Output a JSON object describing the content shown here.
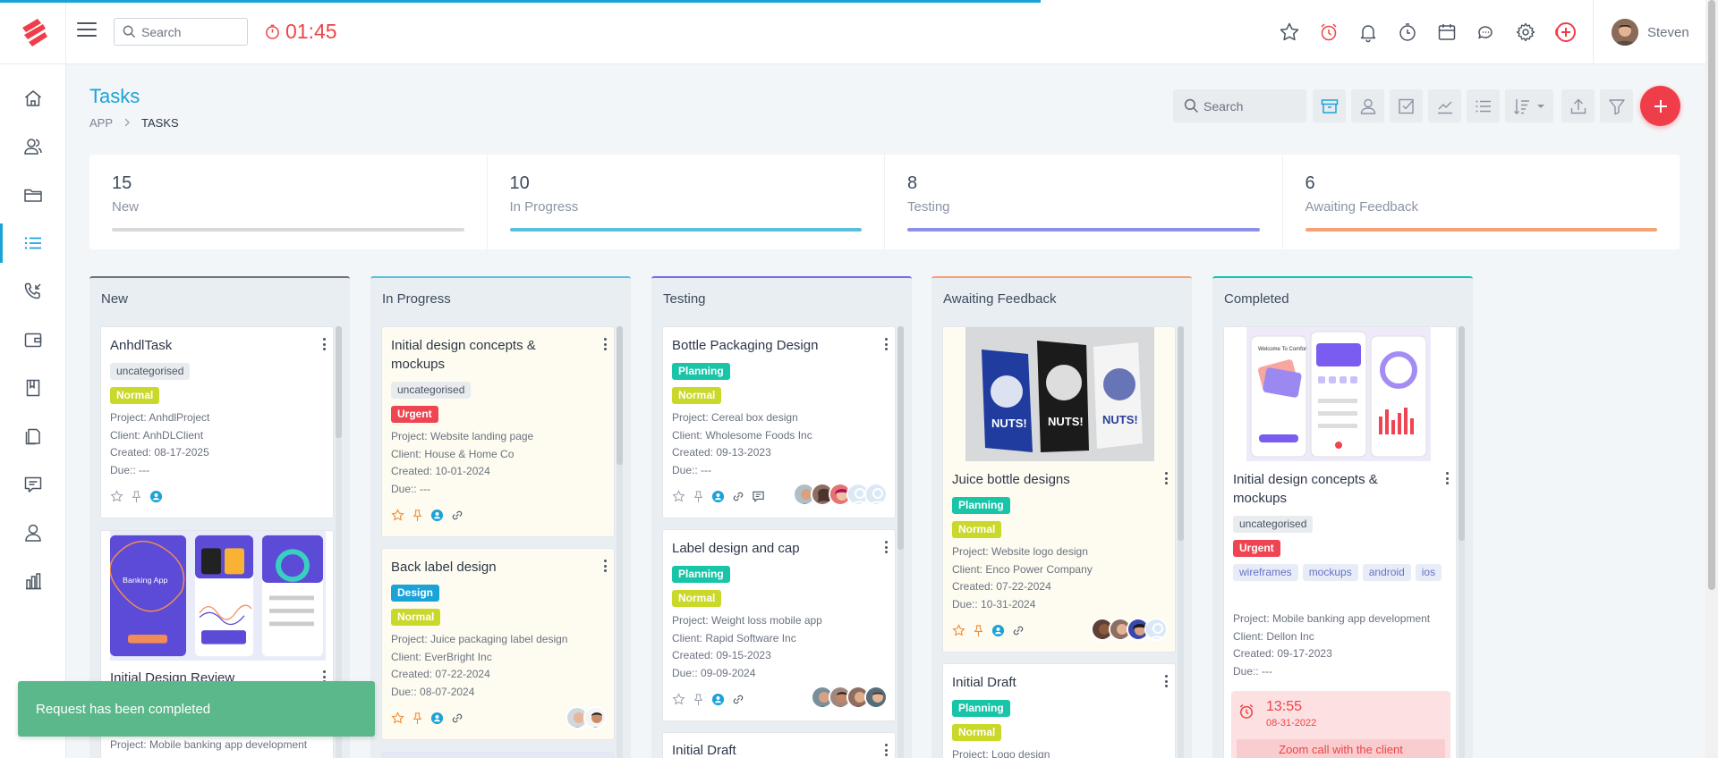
{
  "topbar": {
    "search_placeholder": "Search",
    "timer": "01:45",
    "user_name": "Steven"
  },
  "page": {
    "title": "Tasks",
    "breadcrumb": [
      "APP",
      "TASKS"
    ],
    "search_placeholder": "Search"
  },
  "stats": [
    {
      "count": "15",
      "label": "New",
      "color": "#d9d9d9"
    },
    {
      "count": "10",
      "label": "In Progress",
      "color": "#5bc0de"
    },
    {
      "count": "8",
      "label": "Testing",
      "color": "#8d8fe8"
    },
    {
      "count": "6",
      "label": "Awaiting Feedback",
      "color": "#f7a172"
    }
  ],
  "columns": [
    {
      "title": "New",
      "color": "#9ca3af",
      "cards": [
        {
          "title": "AnhdlTask",
          "tags": [
            "uncategorised",
            "Normal"
          ],
          "project": "Project: AnhdlProject",
          "client": "Client: AnhDLClient",
          "created": "Created: 08-17-2025",
          "due": "Due:: ---"
        },
        {
          "title": "Initial Design Review",
          "project": "Project: Mobile banking app development",
          "image_text": "Banking App"
        }
      ]
    },
    {
      "title": "In Progress",
      "color": "#5bc0de",
      "cards": [
        {
          "title": "Initial design concepts & mockups",
          "tags": [
            "uncategorised",
            "Urgent"
          ],
          "project": "Project: Website landing page",
          "client": "Client: House & Home Co",
          "created": "Created: 10-01-2024",
          "due": "Due:: ---"
        },
        {
          "title": "Back label design",
          "tags": [
            "Design",
            "Normal"
          ],
          "project": "Project: Juice packaging label design",
          "client": "Client: EverBright Inc",
          "created": "Created: 07-22-2024",
          "due": "Due:: 08-07-2024"
        }
      ]
    },
    {
      "title": "Testing",
      "color": "#6d6fe8",
      "cards": [
        {
          "title": "Bottle Packaging Design",
          "tags": [
            "Planning",
            "Normal"
          ],
          "project": "Project: Cereal box design",
          "client": "Client: Wholesome Foods Inc",
          "created": "Created: 09-13-2023",
          "due": "Due:: ---"
        },
        {
          "title": "Label design and cap",
          "tags": [
            "Planning",
            "Normal"
          ],
          "project": "Project: Weight loss mobile app",
          "client": "Client: Rapid Software Inc",
          "created": "Created: 09-15-2023",
          "due": "Due:: 09-09-2024"
        },
        {
          "title": "Initial Draft"
        }
      ]
    },
    {
      "title": "Awaiting Feedback",
      "color": "#f7a172",
      "cards": [
        {
          "title": "Juice bottle designs",
          "tags": [
            "Planning",
            "Normal"
          ],
          "project": "Project: Website logo design",
          "client": "Client: Enco Power Company",
          "created": "Created: 07-22-2024",
          "due": "Due:: 10-31-2024",
          "image_text": "NUTS!"
        },
        {
          "title": "Initial Draft",
          "tags": [
            "Planning",
            "Normal"
          ],
          "project": "Project: Logo design"
        }
      ]
    },
    {
      "title": "Completed",
      "color": "#19c5a8",
      "cards": [
        {
          "title": "Initial design concepts & mockups",
          "tags": [
            "uncategorised",
            "Urgent"
          ],
          "labels": [
            "wireframes",
            "mockups",
            "android",
            "ios"
          ],
          "project": "Project: Mobile banking app development",
          "client": "Client: Dellon Inc",
          "created": "Created: 09-17-2023",
          "due": "Due:: ---",
          "image_text": "Welcome To Comfor",
          "reminder": {
            "time": "13:55",
            "date": "08-31-2022",
            "text": "Zoom call with the client"
          }
        }
      ]
    }
  ],
  "toast": "Request has been completed"
}
